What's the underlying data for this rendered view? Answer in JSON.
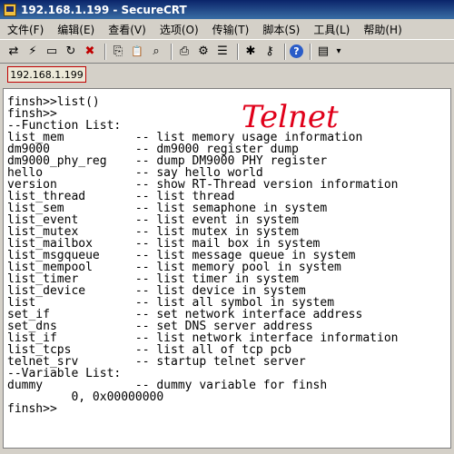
{
  "window": {
    "title": "192.168.1.199 - SecureCRT"
  },
  "menu": [
    {
      "label": "文件(F)"
    },
    {
      "label": "编辑(E)"
    },
    {
      "label": "查看(V)"
    },
    {
      "label": "选项(O)"
    },
    {
      "label": "传输(T)"
    },
    {
      "label": "脚本(S)"
    },
    {
      "label": "工具(L)"
    },
    {
      "label": "帮助(H)"
    }
  ],
  "toolbar": [
    {
      "name": "connect-icon",
      "glyph": "⇄"
    },
    {
      "name": "quick-connect-icon",
      "glyph": "⚡"
    },
    {
      "name": "connect-tab-icon",
      "glyph": "▭"
    },
    {
      "name": "reconnect-icon",
      "glyph": "↻"
    },
    {
      "name": "disconnect-icon",
      "glyph": "✖"
    },
    {
      "name": "copy-icon",
      "glyph": "⎘"
    },
    {
      "name": "paste-icon",
      "glyph": "📋"
    },
    {
      "name": "find-icon",
      "glyph": "⌕"
    },
    {
      "name": "print-icon",
      "glyph": "⎙"
    },
    {
      "name": "print-setup-icon",
      "glyph": "⚙"
    },
    {
      "name": "properties-icon",
      "glyph": "☰"
    },
    {
      "name": "options-icon",
      "glyph": "✱"
    },
    {
      "name": "keymap-icon",
      "glyph": "⚷"
    },
    {
      "name": "help-icon",
      "glyph": "?"
    },
    {
      "name": "sftp-icon",
      "glyph": "▤"
    },
    {
      "name": "toolbar-dropdown-icon",
      "glyph": "▾"
    }
  ],
  "tab": {
    "label": "192.168.1.199"
  },
  "overlay_text": "Telnet",
  "terminal": {
    "lines": [
      "finsh>>list()",
      "",
      "finsh>>",
      "",
      "--Function List:",
      "list_mem          -- list memory usage information",
      "dm9000            -- dm9000 register dump",
      "dm9000_phy_reg    -- dump DM9000 PHY register",
      "hello             -- say hello world",
      "version           -- show RT-Thread version information",
      "list_thread       -- list thread",
      "list_sem          -- list semaphone in system",
      "list_event        -- list event in system",
      "list_mutex        -- list mutex in system",
      "list_mailbox      -- list mail box in system",
      "list_msgqueue     -- list message queue in system",
      "list_mempool      -- list memory pool in system",
      "list_timer        -- list timer in system",
      "list_device       -- list device in system",
      "list              -- list all symbol in system",
      "set_if            -- set network interface address",
      "set_dns           -- set DNS server address",
      "list_if           -- list network interface information",
      "list_tcps         -- list all of tcp pcb",
      "telnet_srv        -- startup telnet server",
      "--Variable List:",
      "dummy             -- dummy variable for finsh",
      "         0, 0x00000000",
      "finsh>>"
    ]
  }
}
